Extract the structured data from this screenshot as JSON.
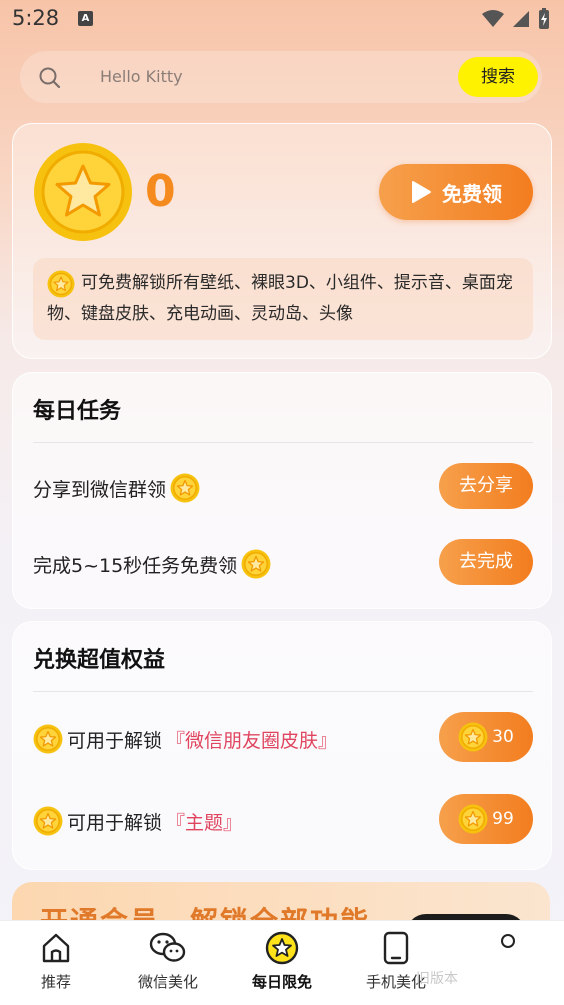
{
  "status": {
    "time": "5:28",
    "a_icon": "A"
  },
  "search": {
    "placeholder": "Hello Kitty",
    "button": "搜索"
  },
  "coin_card": {
    "balance": "0",
    "free_button": "免费领",
    "notice": "可免费解锁所有壁纸、裸眼3D、小组件、提示音、桌面宠物、键盘皮肤、充电动画、灵动岛、头像"
  },
  "tasks": {
    "title": "每日任务",
    "items": [
      {
        "label": "分享到微信群领",
        "action": "去分享"
      },
      {
        "label": "完成5~15秒任务免费领",
        "action": "去完成"
      }
    ]
  },
  "exchange": {
    "title": "兑换超值权益",
    "items": [
      {
        "prefix": "可用于解锁",
        "target": "『微信朋友圈皮肤』",
        "cost": "30"
      },
      {
        "prefix": "可用于解锁",
        "target": "『主题』",
        "cost": "99"
      }
    ]
  },
  "banner": {
    "text": "开通会员，解锁全部功能"
  },
  "tabs": [
    {
      "label": "推荐",
      "icon": "home-icon"
    },
    {
      "label": "微信美化",
      "icon": "wechat-icon"
    },
    {
      "label": "每日限免",
      "icon": "star-coin-icon"
    },
    {
      "label": "手机美化",
      "icon": "phone-icon"
    }
  ],
  "watermark": "旧版本",
  "colors": {
    "accent": "#f58b1f",
    "search_button": "#fff200",
    "highlight": "#e0455f"
  }
}
